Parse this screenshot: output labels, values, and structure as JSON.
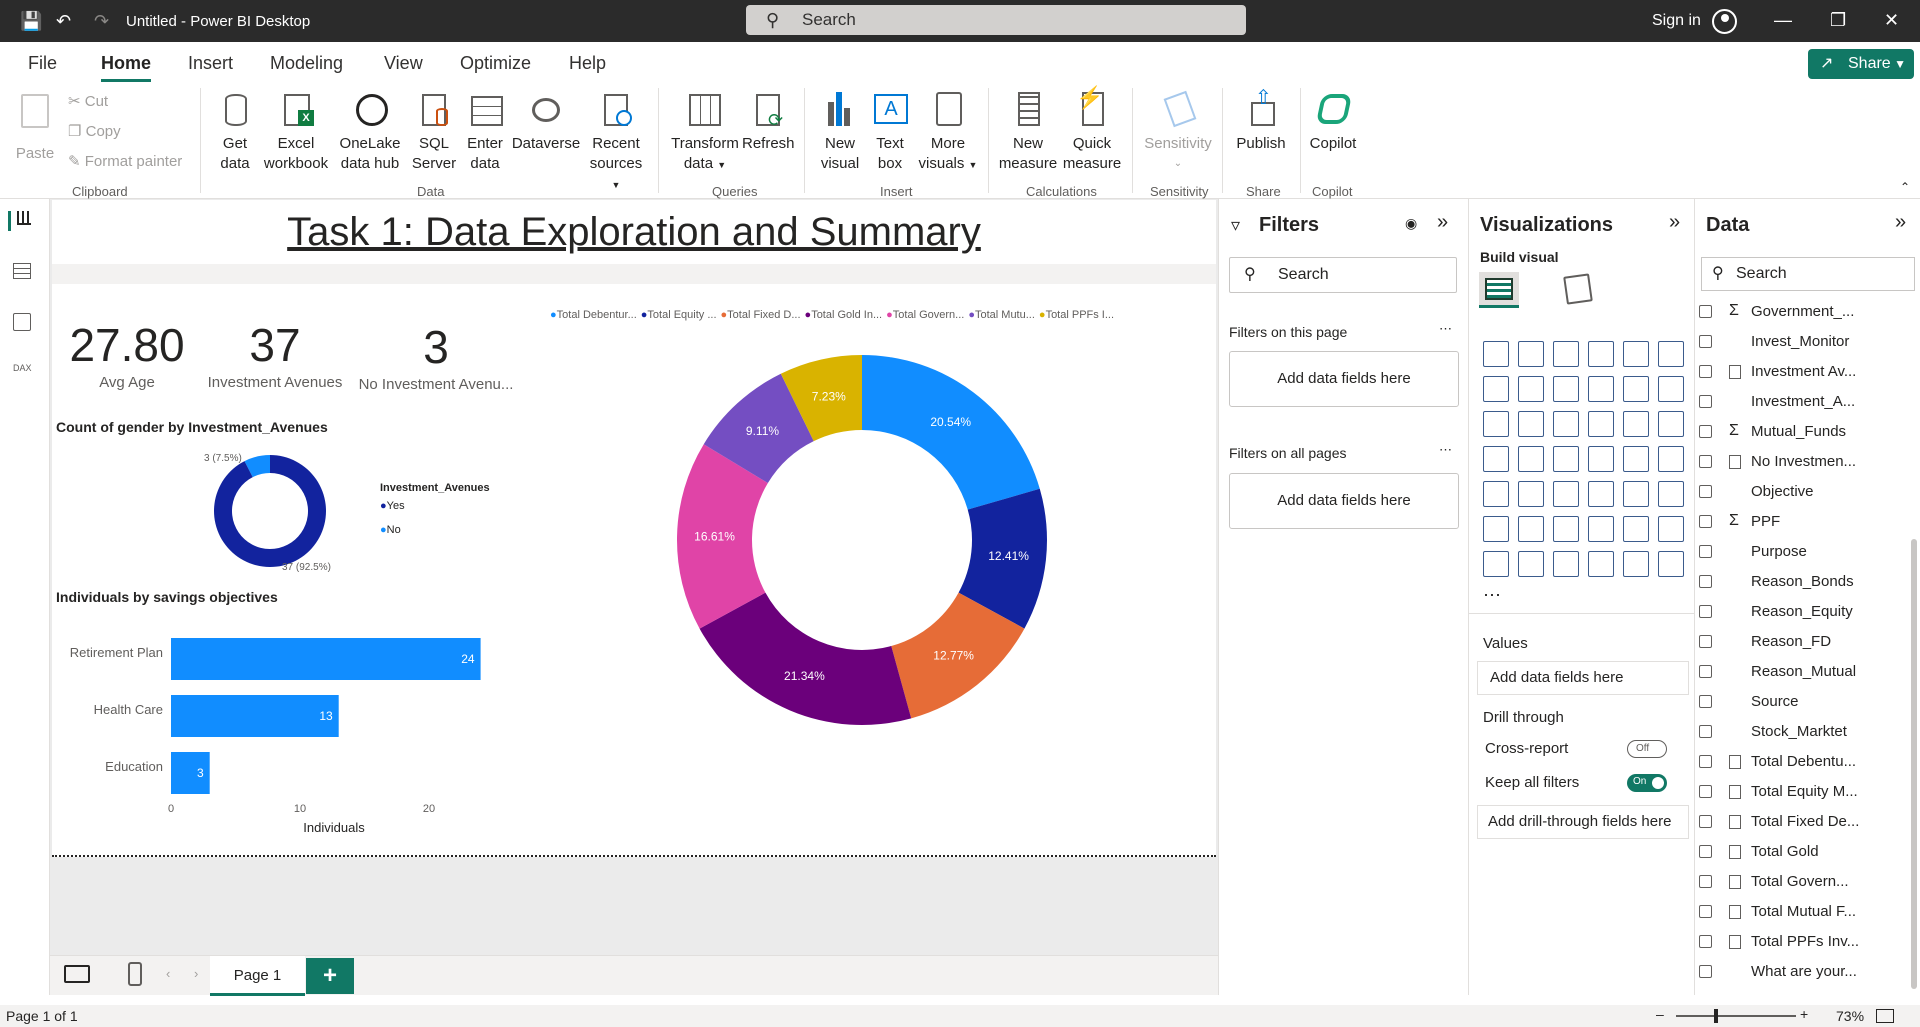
{
  "titlebar": {
    "app_title": "Untitled - Power BI Desktop",
    "search_placeholder": "Search",
    "signin": "Sign in"
  },
  "menus": [
    "File",
    "Home",
    "Insert",
    "Modeling",
    "View",
    "Optimize",
    "Help"
  ],
  "share_label": "Share",
  "ribbon": {
    "paste": "Paste",
    "cut": "Cut",
    "copy": "Copy",
    "format_painter": "Format painter",
    "get_data": [
      "Get",
      "data"
    ],
    "excel": [
      "Excel",
      "workbook"
    ],
    "onelake": [
      "OneLake",
      "data hub"
    ],
    "sql": [
      "SQL",
      "Server"
    ],
    "enter": [
      "Enter",
      "data"
    ],
    "dataverse": [
      "Dataverse",
      ""
    ],
    "recent": [
      "Recent",
      "sources"
    ],
    "transform": [
      "Transform",
      "data"
    ],
    "refresh": [
      "Refresh",
      ""
    ],
    "new_visual": [
      "New",
      "visual"
    ],
    "text_box": [
      "Text",
      "box"
    ],
    "more_visuals": [
      "More",
      "visuals"
    ],
    "new_measure": [
      "New",
      "measure"
    ],
    "quick_measure": [
      "Quick",
      "measure"
    ],
    "sensitivity": [
      "Sensitivity",
      ""
    ],
    "publish": [
      "Publish",
      ""
    ],
    "copilot": [
      "Copilot",
      ""
    ],
    "groups": [
      "Clipboard",
      "Data",
      "Queries",
      "Insert",
      "Calculations",
      "Sensitivity",
      "Share",
      "Copilot"
    ]
  },
  "report": {
    "title": "Task 1: Data Exploration and Summary",
    "cards": [
      {
        "value": "27.80",
        "label": "Avg Age"
      },
      {
        "value": "37",
        "label": "Investment Avenues"
      },
      {
        "value": "3",
        "label": "No Investment Avenu..."
      }
    ],
    "donut_small": {
      "title": "Count of gender by Investment_Avenues",
      "legend_title": "Investment_Avenues",
      "slices": [
        {
          "name": "Yes",
          "value": 37,
          "label": "37 (92.5%)",
          "color": "#12239e"
        },
        {
          "name": "No",
          "value": 3,
          "label": "3 (7.5%)",
          "color": "#118dff"
        }
      ]
    },
    "bar": {
      "title": "Individuals by savings objectives",
      "xlabel": "Individuals",
      "ticks": [
        "0",
        "10",
        "20"
      ]
    },
    "donut_big": {
      "legend": [
        "Total Debentur...",
        "Total Equity ...",
        "Total Fixed D...",
        "Total Gold In...",
        "Total Govern...",
        "Total Mutu...",
        "Total PPFs I..."
      ]
    }
  },
  "chart_data": [
    {
      "type": "bar",
      "title": "Individuals by savings objectives",
      "categories": [
        "Retirement Plan",
        "Health Care",
        "Education"
      ],
      "values": [
        24,
        13,
        3
      ],
      "xlabel": "Individuals",
      "xlim": [
        0,
        25
      ],
      "color": "#118dff"
    },
    {
      "type": "pie",
      "title": "Count of gender by Investment_Avenues",
      "categories": [
        "Yes",
        "No"
      ],
      "values": [
        37,
        3
      ],
      "colors": [
        "#12239e",
        "#118dff"
      ]
    },
    {
      "type": "pie",
      "categories": [
        "Total Debentur...",
        "Total Equity ...",
        "Total Fixed D...",
        "Total Gold In...",
        "Total Govern...",
        "Total Mutu...",
        "Total PPFs I..."
      ],
      "values": [
        20.54,
        12.41,
        12.77,
        21.34,
        16.61,
        9.11,
        7.23
      ],
      "colors": [
        "#118dff",
        "#12239e",
        "#e66c37",
        "#6b007b",
        "#e044a7",
        "#744ec2",
        "#d9b300"
      ]
    }
  ],
  "pages": {
    "tab": "Page 1",
    "add": "+"
  },
  "status": {
    "page": "Page 1 of 1",
    "zoom": "73%"
  },
  "filters": {
    "title": "Filters",
    "search": "Search",
    "on_page": "Filters on this page",
    "on_all": "Filters on all pages",
    "add": "Add data fields here"
  },
  "viz": {
    "title": "Visualizations",
    "build": "Build visual",
    "values": "Values",
    "add_fields": "Add data fields here",
    "drill": "Drill through",
    "cross": "Cross-report",
    "cross_state": "Off",
    "keep": "Keep all filters",
    "keep_state": "On",
    "add_drill": "Add drill-through fields here"
  },
  "data": {
    "title": "Data",
    "search": "Search",
    "fields": [
      {
        "name": "Government_...",
        "kind": "sigma"
      },
      {
        "name": "Invest_Monitor",
        "kind": "text"
      },
      {
        "name": "Investment Av...",
        "kind": "calc"
      },
      {
        "name": "Investment_A...",
        "kind": "text"
      },
      {
        "name": "Mutual_Funds",
        "kind": "sigma"
      },
      {
        "name": "No Investmen...",
        "kind": "calc"
      },
      {
        "name": "Objective",
        "kind": "text"
      },
      {
        "name": "PPF",
        "kind": "sigma"
      },
      {
        "name": "Purpose",
        "kind": "text"
      },
      {
        "name": "Reason_Bonds",
        "kind": "text"
      },
      {
        "name": "Reason_Equity",
        "kind": "text"
      },
      {
        "name": "Reason_FD",
        "kind": "text"
      },
      {
        "name": "Reason_Mutual",
        "kind": "text"
      },
      {
        "name": "Source",
        "kind": "text"
      },
      {
        "name": "Stock_Marktet",
        "kind": "text"
      },
      {
        "name": "Total Debentu...",
        "kind": "calc"
      },
      {
        "name": "Total Equity M...",
        "kind": "calc"
      },
      {
        "name": "Total Fixed De...",
        "kind": "calc"
      },
      {
        "name": "Total Gold",
        "kind": "calc"
      },
      {
        "name": "Total Govern...",
        "kind": "calc"
      },
      {
        "name": "Total Mutual F...",
        "kind": "calc"
      },
      {
        "name": "Total PPFs Inv...",
        "kind": "calc"
      },
      {
        "name": "What are your...",
        "kind": "text"
      }
    ]
  }
}
